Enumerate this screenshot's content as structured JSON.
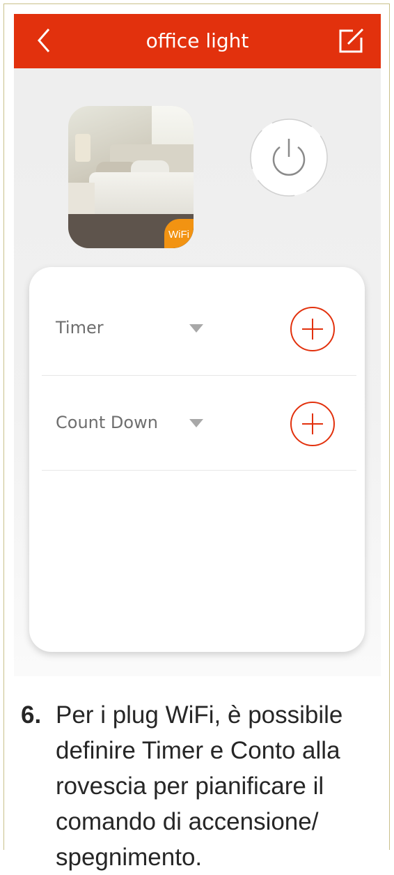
{
  "header": {
    "title": "office light",
    "back_icon": "chevron-left-icon",
    "edit_icon": "edit-icon"
  },
  "device": {
    "image": "bedroom-photo",
    "badge_label": "WiFi",
    "power_icon": "power-icon"
  },
  "schedule": {
    "rows": [
      {
        "label": "Timer",
        "dropdown_icon": "caret-down-icon",
        "add_icon": "plus-circle-icon"
      },
      {
        "label": "Count Down",
        "dropdown_icon": "caret-down-icon",
        "add_icon": "plus-circle-icon"
      }
    ]
  },
  "caption": {
    "number": "6.",
    "text": "Per i plug WiFi, è possibile definire Timer e Conto alla rovescia per pianificare il comando di accensione/ spegnimento."
  },
  "colors": {
    "header_bg": "#e2310d",
    "accent": "#e2310d",
    "badge": "#f29312"
  }
}
